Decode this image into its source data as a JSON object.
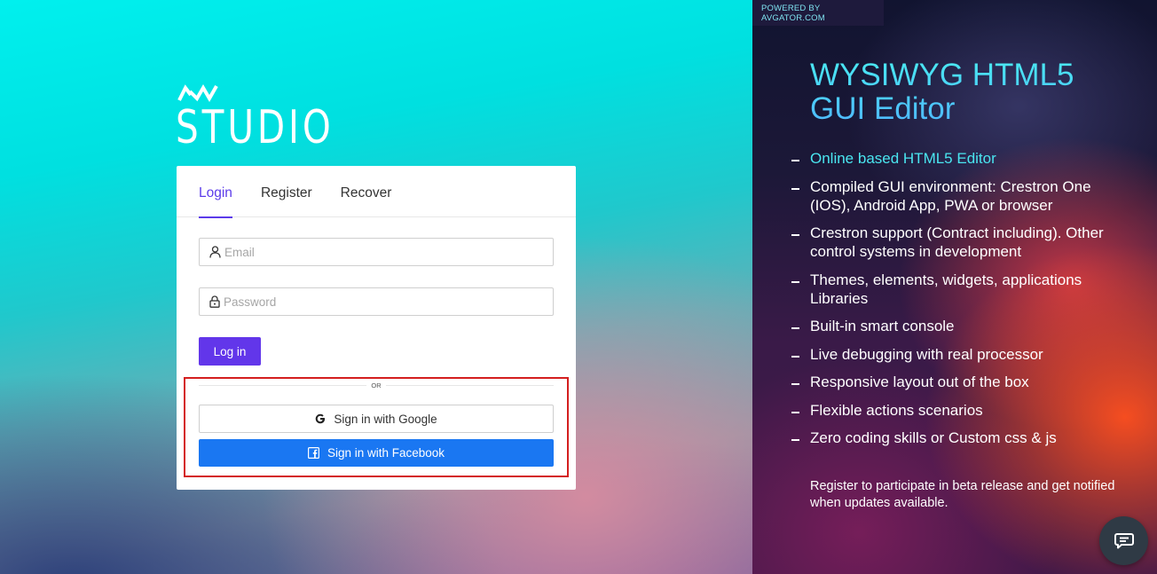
{
  "logo": {
    "text": "STUDIO",
    "mark_icon": "av-logo-icon"
  },
  "tabs": [
    {
      "label": "Login",
      "active": true
    },
    {
      "label": "Register",
      "active": false
    },
    {
      "label": "Recover",
      "active": false
    }
  ],
  "form": {
    "email": {
      "placeholder": "Email",
      "value": "",
      "icon": "user-icon"
    },
    "password": {
      "placeholder": "Password",
      "value": "",
      "icon": "lock-icon"
    },
    "login_label": "Log in",
    "or_label": "OR",
    "google_label": "Sign in with Google",
    "google_icon": "google-icon",
    "facebook_label": "Sign in with Facebook",
    "facebook_icon": "facebook-icon"
  },
  "right_panel": {
    "powered_by": "POWERED BY AVGATOR.COM",
    "heading": "WYSIWYG HTML5 GUI Editor",
    "features": [
      "Online based HTML5 Editor",
      "Compiled GUI environment: Crestron One (IOS), Android App, PWA or browser",
      "Crestron support (Contract including). Other control systems in development",
      "Themes, elements, widgets, applications Libraries",
      "Built-in smart console",
      "Live debugging with real processor",
      "Responsive layout out of the box",
      "Flexible actions scenarios",
      "Zero coding skills or Custom css & js"
    ],
    "register_note": "Register to participate in beta release and get notified when updates available.",
    "chat_icon": "chat-icon"
  },
  "colors": {
    "accent": "#6236ea",
    "facebook": "#1a77f2",
    "highlight": "#d41f1f",
    "feature_highlight": "#4ae6f0"
  }
}
